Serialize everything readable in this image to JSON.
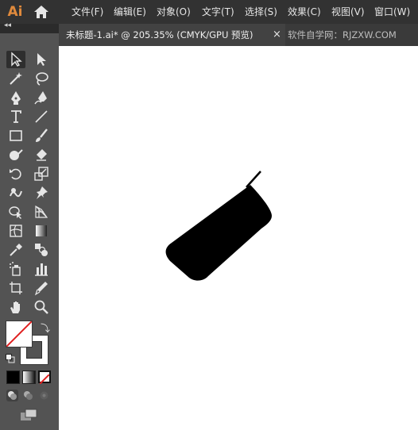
{
  "app": {
    "logo_text": "Ai",
    "home_icon": "home-icon"
  },
  "menu": {
    "items": [
      "文件(F)",
      "编辑(E)",
      "对象(O)",
      "文字(T)",
      "选择(S)",
      "效果(C)",
      "视图(V)",
      "窗口(W)"
    ]
  },
  "document_tab": {
    "label": "未标题-1.ai* @ 205.35% (CMYK/GPU 预览)",
    "close": "×"
  },
  "watermark": "软件自学网：RJZXW.COM",
  "toolbar": {
    "collapse": "◂◂",
    "tools": [
      "selection-tool",
      "direct-selection-tool",
      "magic-wand-tool",
      "lasso-tool",
      "pen-tool",
      "curvature-tool",
      "type-tool",
      "line-segment-tool",
      "rectangle-tool",
      "paintbrush-tool",
      "shaper-tool",
      "eraser-tool",
      "rotate-tool",
      "scale-tool",
      "warp-tool",
      "puppet-warp-tool",
      "shape-builder-tool",
      "perspective-grid-tool",
      "mesh-tool",
      "gradient-tool",
      "eyedropper-tool",
      "blend-tool",
      "symbol-sprayer-tool",
      "column-graph-tool",
      "artboard-tool",
      "slice-tool",
      "hand-tool",
      "zoom-tool"
    ],
    "active_tool": "selection-tool",
    "fill": "none",
    "stroke": "#000000"
  },
  "colors": {
    "menubar_bg": "#323232",
    "panel_bg": "#535353",
    "canvas_bg": "#ffffff",
    "logo": "#e08a3c",
    "artwork": "#000000"
  }
}
